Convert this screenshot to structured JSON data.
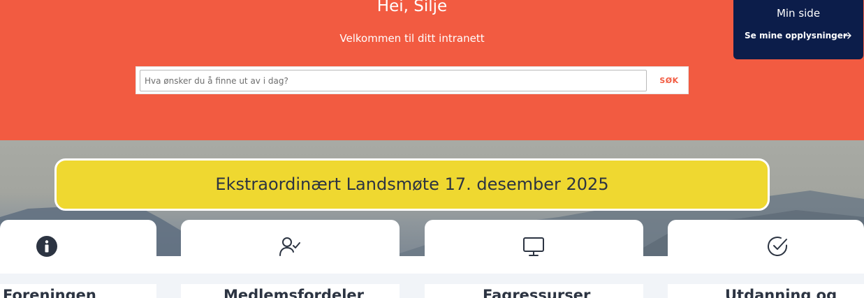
{
  "hero": {
    "greeting": "Hei, Silje",
    "subtitle": "Velkommen til ditt intranett"
  },
  "search": {
    "placeholder": "Hva ønsker du å finne ut av i dag?",
    "button_label": "SØK"
  },
  "min_side": {
    "title": "Min side",
    "link_label": "Se mine opplysninger",
    "arrow_icon": "arrow-right-icon"
  },
  "banner": {
    "text": "Ekstraordinært Landsmøte 17. desember 2025"
  },
  "cards": [
    {
      "title": "Foreningen",
      "icon": "info-circle-icon"
    },
    {
      "title": "Medlemsfordeler",
      "icon": "user-check-icon"
    },
    {
      "title": "Fagressurser",
      "icon": "monitor-icon"
    },
    {
      "title": "Utdanning og",
      "icon": "check-circle-icon"
    }
  ],
  "colors": {
    "hero_bg": "#f25b41",
    "min_side_bg": "#0c1d4a",
    "banner_bg": "#efd830",
    "text_dark": "#2c3442"
  }
}
